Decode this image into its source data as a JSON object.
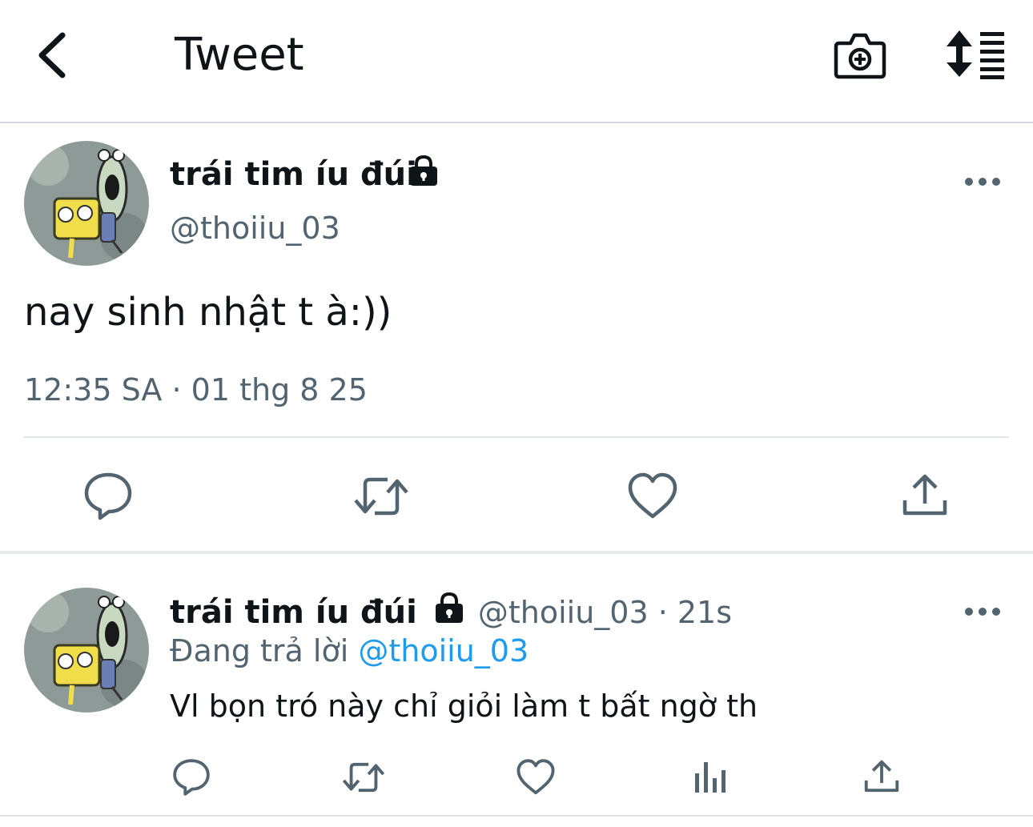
{
  "header": {
    "title": "Tweet",
    "back_icon": "chevron-left-icon",
    "camera_icon": "camera-plus-icon",
    "sort_icon": "sort-list-icon"
  },
  "main_tweet": {
    "author_name": "trái tim íu đúi",
    "handle": "@thoiiu_03",
    "protected_icon": "lock-icon",
    "more_icon": "more-horizontal-icon",
    "text": "nay sinh nhật t à:))",
    "timestamp": "12:35 SA · 01 thg 8 25",
    "actions": [
      "reply-icon",
      "retweet-icon",
      "like-icon",
      "share-icon"
    ]
  },
  "reply_tweet": {
    "author_name": "trái tim íu đúi",
    "meta": "@thoiiu_03 · 21s",
    "protected_icon": "lock-icon",
    "more_icon": "more-horizontal-icon",
    "replying_prefix": "Đang trả lời",
    "replying_handle": "@thoiiu_03",
    "text": "Vl bọn tró này chỉ giỏi làm t bất ngờ th",
    "actions": [
      "reply-icon",
      "retweet-icon",
      "like-icon",
      "views-icon",
      "share-icon"
    ]
  },
  "colors": {
    "text_primary": "#0f1419",
    "text_secondary": "#536471",
    "link": "#1d9bf0",
    "divider": "#e1e4e8"
  }
}
